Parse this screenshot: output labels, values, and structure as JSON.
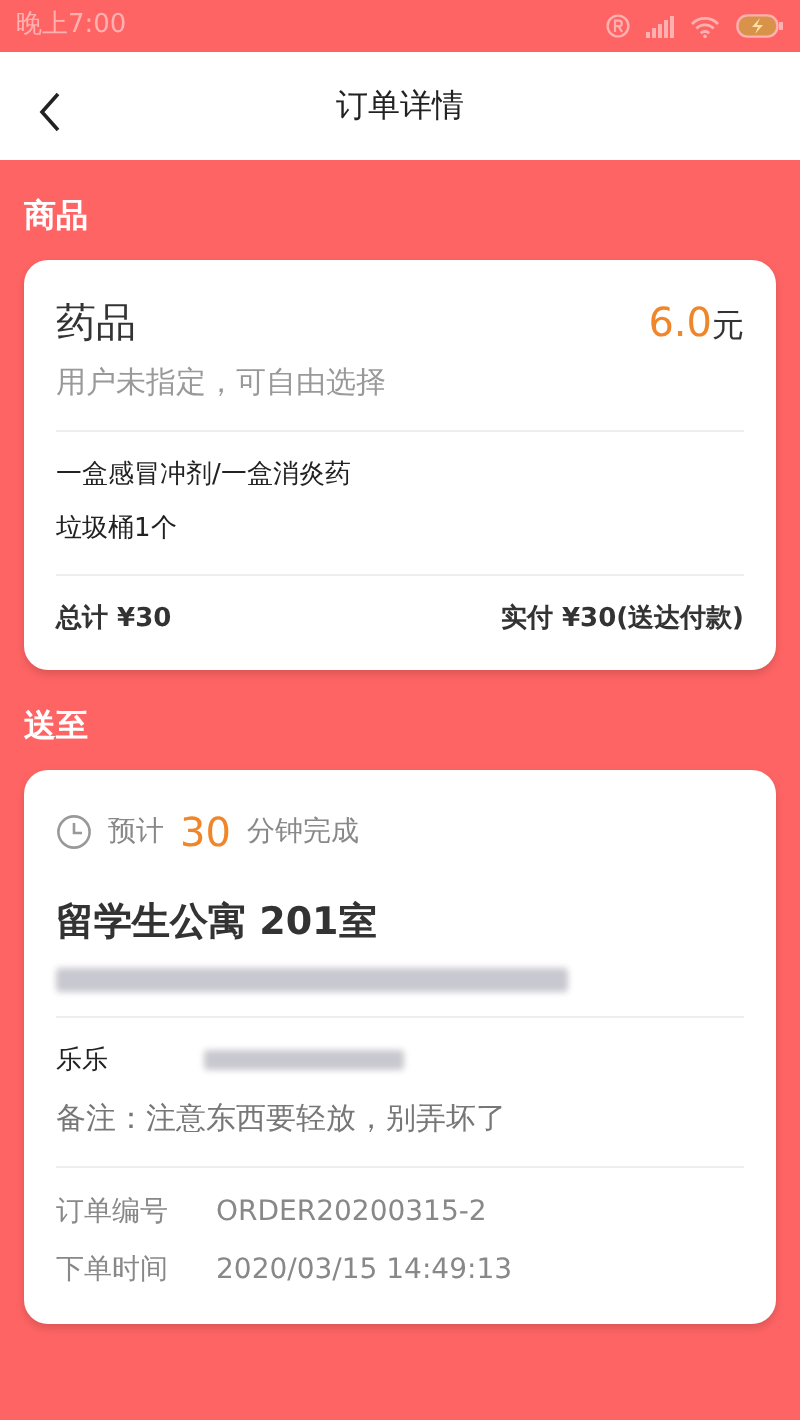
{
  "status_bar": {
    "time": "晚上7:00"
  },
  "header": {
    "title": "订单详情"
  },
  "goods": {
    "section_title": "商品",
    "name": "药品",
    "price": "6.0",
    "price_unit": "元",
    "note": "用户未指定，可自由选择",
    "items": [
      "一盒感冒冲剂/一盒消炎药",
      "垃圾桶1个"
    ],
    "total": "总计 ¥30",
    "paid": "实付 ¥30(送达付款)"
  },
  "delivery": {
    "section_title": "送至",
    "eta_prefix": "预计",
    "eta_minutes": "30",
    "eta_suffix": "分钟完成",
    "place": "留学生公寓 201室",
    "contact_name": "乐乐",
    "remark": "备注：注意东西要轻放，别弄坏了",
    "details": [
      {
        "label": "订单编号",
        "value": "ORDER20200315-2"
      },
      {
        "label": "下单时间",
        "value": "2020/03/15 14:49:13"
      }
    ]
  }
}
